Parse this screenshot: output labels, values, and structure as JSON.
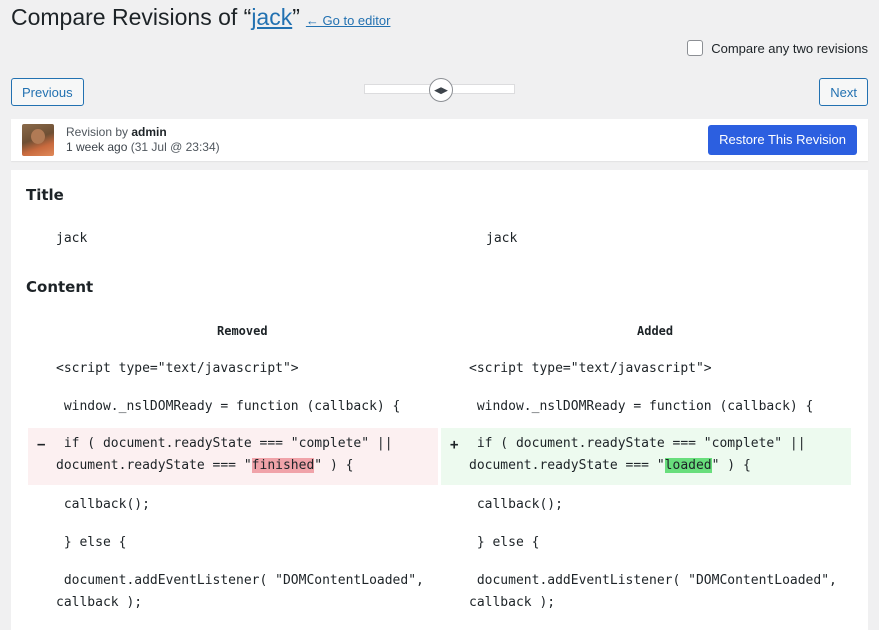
{
  "header": {
    "title_prefix": "Compare Revisions of “",
    "title_link": "jack",
    "title_suffix": "”",
    "goto_editor": "← Go to editor"
  },
  "compare_two": {
    "label": "Compare any two revisions",
    "checked": false
  },
  "nav": {
    "previous": "Previous",
    "next": "Next"
  },
  "revision": {
    "by_prefix": "Revision by ",
    "author": "admin",
    "time": "1 week ago",
    "date": "(31 Jul @ 23:34)",
    "restore": "Restore This Revision"
  },
  "title_section": {
    "heading": "Title",
    "left": "jack",
    "right": "jack"
  },
  "content_section": {
    "heading": "Content",
    "removed_label": "Removed",
    "added_label": "Added",
    "lines": [
      {
        "left": "<script type=\"text/javascript\">",
        "right": "<script type=\"text/javascript\">"
      },
      {
        "left": " window._nslDOMReady = function (callback) {",
        "right": " window._nslDOMReady = function (callback) {"
      },
      {
        "left": " callback();",
        "right": " callback();"
      },
      {
        "left": " } else {",
        "right": " } else {"
      },
      {
        "left": " document.addEventListener( \"DOMContentLoaded\",",
        "right": " document.addEventListener( \"DOMContentLoaded\","
      },
      {
        "left": "callback );",
        "right": "callback );"
      }
    ],
    "changed": {
      "minus": "−",
      "plus": "+",
      "del_line1": " if ( document.readyState === \"complete\" ||",
      "del_line2_pre": "document.readyState === \"",
      "del_word": "finished",
      "del_line2_post": "\" ) {",
      "add_line1": " if ( document.readyState === \"complete\" ||",
      "add_line2_pre": "document.readyState === \"",
      "add_word": "loaded",
      "add_line2_post": "\" ) {"
    }
  },
  "colors": {
    "primary": "#2c5fe0",
    "link": "#2271b1",
    "removed_bg": "#fcf0f1",
    "added_bg": "#edfaef"
  }
}
